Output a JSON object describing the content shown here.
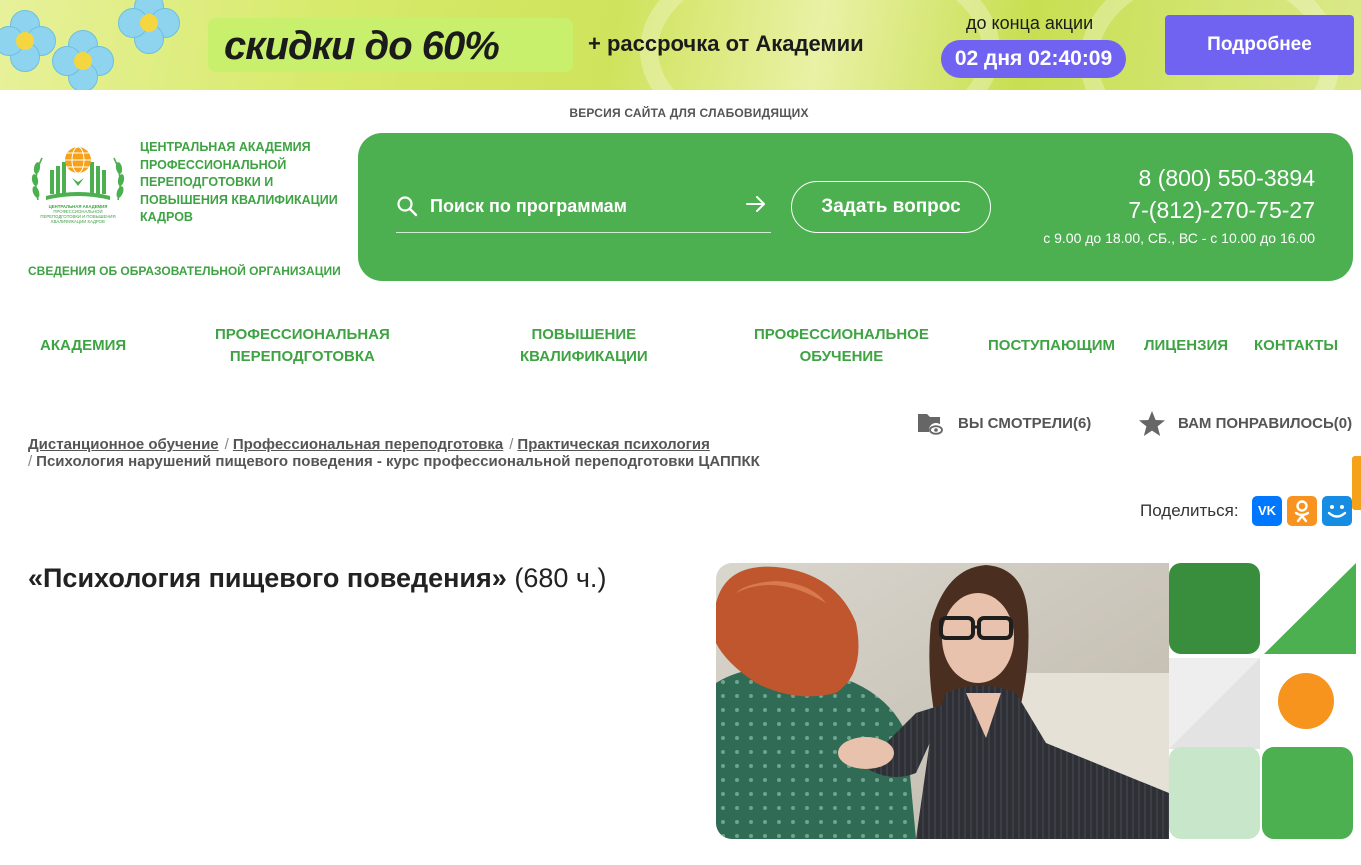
{
  "promo": {
    "headline": "скидки до 60%",
    "subtitle": "+ рассрочка от Академии",
    "until_label": "до конца акции",
    "timer": "02 дня 02:40:09",
    "button_label": "Подробнее"
  },
  "header": {
    "accessible_link": "ВЕРСИЯ САЙТА ДЛЯ СЛАБОВИДЯЩИХ",
    "logo_text": "ЦЕНТРАЛЬНАЯ АКАДЕМИЯ ПРОФЕССИОНАЛЬНОЙ ПЕРЕПОДГОТОВКИ И ПОВЫШЕНИЯ КВАЛИФИКАЦИИ КАДРОВ",
    "logo_small_text": "ЦЕНТРАЛЬНАЯ АКАДЕМИЯ ПРОФЕССИОНАЛЬНОЙ ПЕРЕПОДГОТОВКИ И ПОВЫШЕНИЯ КВАЛИФИКАЦИИ КАДРОВ",
    "org_info_link": "СВЕДЕНИЯ ОБ ОБРАЗОВАТЕЛЬНОЙ ОРГАНИЗАЦИИ",
    "search_placeholder": "Поиск по программам",
    "ask_button": "Задать вопрос",
    "phone_1": "8 (800) 550-3894",
    "phone_2": "7-(812)-270-75-27",
    "hours": "с 9.00 до 18.00, СБ., ВС - с 10.00 до 16.00"
  },
  "nav": {
    "items": [
      {
        "label": "АКАДЕМИЯ"
      },
      {
        "line1": "ПРОФЕССИОНАЛЬНАЯ",
        "line2": "ПЕРЕПОДГОТОВКА"
      },
      {
        "line1": "ПОВЫШЕНИЕ",
        "line2": "КВАЛИФИКАЦИИ"
      },
      {
        "line1": "ПРОФЕССИОНАЛЬНОЕ",
        "line2": "ОБУЧЕНИЕ"
      },
      {
        "label": "ПОСТУПАЮЩИМ"
      },
      {
        "label": "ЛИЦЕНЗИЯ"
      },
      {
        "label": "КОНТАКТЫ"
      }
    ]
  },
  "user_lists": {
    "viewed": "ВЫ СМОТРЕЛИ(6)",
    "liked": "ВАМ ПОНРАВИЛОСЬ(0)"
  },
  "breadcrumbs": {
    "items": [
      "Дистанционное обучение",
      "Профессиональная переподготовка",
      "Практическая психология"
    ],
    "current": "Психология нарушений пищевого поведения - курс профессиональной переподготовки ЦАППКК"
  },
  "share": {
    "label": "Поделиться:",
    "buttons": [
      {
        "icon": "vk-icon",
        "text": "VK",
        "color": "#0077ff"
      },
      {
        "icon": "odnoklassniki-icon",
        "text": "ОК",
        "color": "#f7931e"
      },
      {
        "icon": "moimir-icon",
        "text": "",
        "color": "#168de2"
      }
    ]
  },
  "course": {
    "title": "«Психология пищевого поведения»",
    "hours": "(680 ч.)"
  },
  "colors": {
    "brand_green": "#4caf50",
    "text_green": "#3ea343",
    "promo_purple": "#7163f2",
    "accent_orange": "#f5a11a"
  }
}
